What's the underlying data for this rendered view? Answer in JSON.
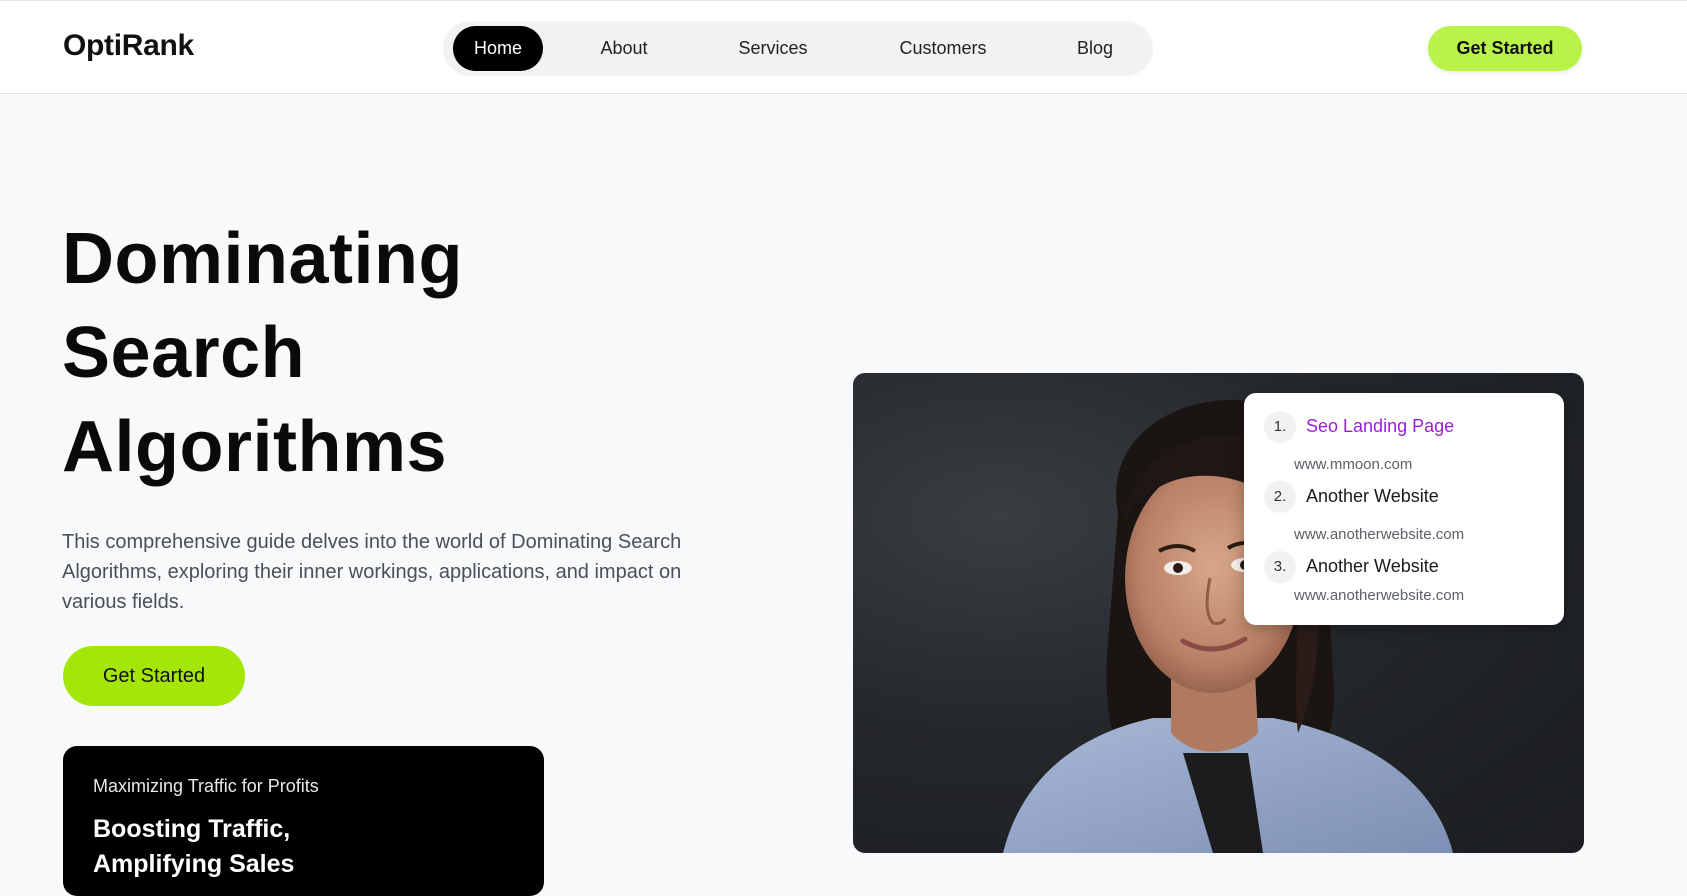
{
  "brand": {
    "name": "OptiRank"
  },
  "nav": {
    "items": [
      {
        "label": "Home",
        "active": true
      },
      {
        "label": "About",
        "active": false
      },
      {
        "label": "Services",
        "active": false
      },
      {
        "label": "Customers",
        "active": false
      },
      {
        "label": "Blog",
        "active": false
      }
    ],
    "cta_label": "Get Started"
  },
  "hero": {
    "title_lines": [
      "Dominating",
      "Search",
      "Algorithms"
    ],
    "description": "This comprehensive guide delves into the world of Dominating Search Algorithms, exploring their inner workings, applications, and impact on various fields.",
    "cta_label": "Get Started"
  },
  "feature_card": {
    "eyebrow": "Maximizing Traffic for Profits",
    "title": "Boosting Traffic, Amplifying Sales"
  },
  "search_results": [
    {
      "rank": "1.",
      "title": "Seo Landing Page",
      "url": "www.mmoon.com",
      "highlighted": true
    },
    {
      "rank": "2.",
      "title": "Another Website",
      "url": "www.anotherwebsite.com",
      "highlighted": false
    },
    {
      "rank": "3.",
      "title": "Another Website",
      "url": "www.anotherwebsite.com",
      "highlighted": false
    }
  ],
  "colors": {
    "accent_lime": "#b9f34a",
    "accent_lime_strong": "#a3e608",
    "highlight_purple": "#9b1ee0",
    "nav_active_bg": "#000000"
  }
}
